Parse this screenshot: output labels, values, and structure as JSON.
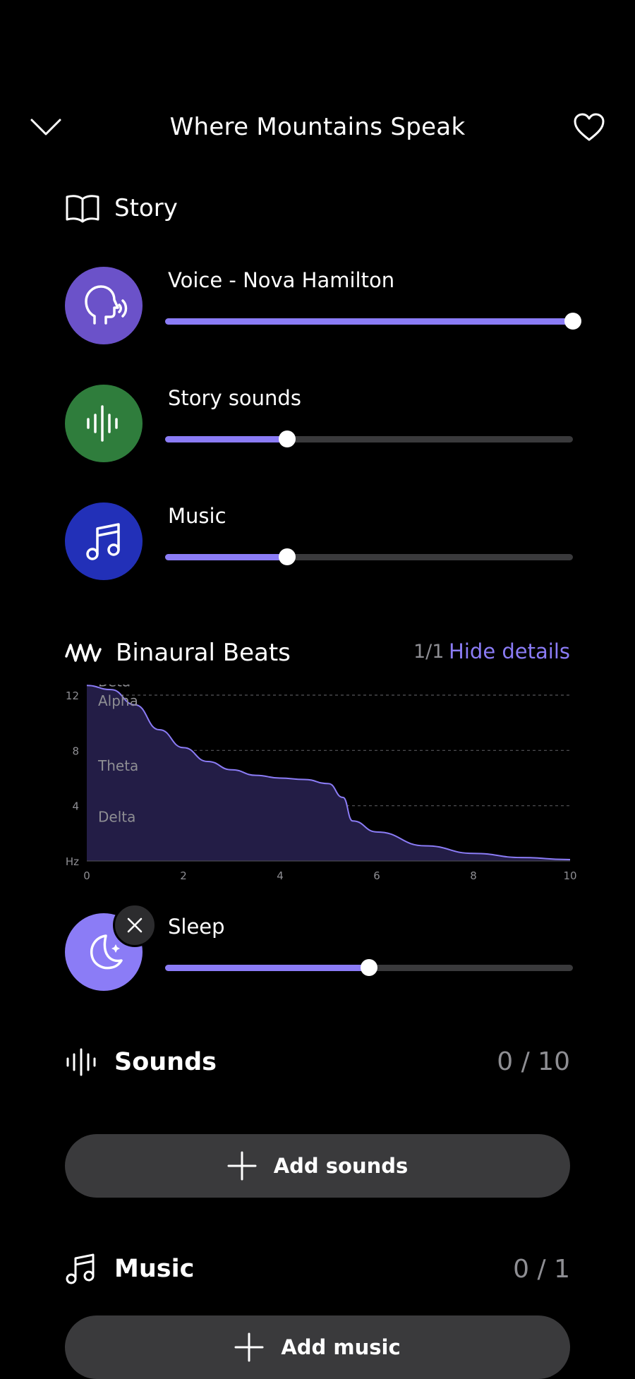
{
  "header": {
    "title": "Where Mountains Speak"
  },
  "story": {
    "label": "Story",
    "rows": [
      {
        "label": "Voice - Nova Hamilton",
        "level": 1.0,
        "color": "#6b52c9"
      },
      {
        "label": "Story sounds",
        "level": 0.3,
        "color": "#2f7d3c"
      },
      {
        "label": "Music",
        "level": 0.3,
        "color": "#2230b8"
      }
    ]
  },
  "binaural": {
    "label": "Binaural Beats",
    "count": "1/1",
    "toggle_label": "Hide details",
    "accent": "#8b7cf6"
  },
  "chart_data": {
    "type": "area",
    "x": [
      0,
      0.5,
      1,
      1.5,
      2,
      2.5,
      3,
      3.5,
      4,
      4.5,
      5,
      5.3,
      5.5,
      6,
      7,
      8,
      9,
      10
    ],
    "y": [
      12.7,
      12.4,
      11.3,
      9.5,
      8.2,
      7.2,
      6.6,
      6.2,
      6.0,
      5.9,
      5.6,
      4.6,
      2.9,
      2.1,
      1.1,
      0.55,
      0.25,
      0.1
    ],
    "xlim": [
      0,
      10
    ],
    "ylim": [
      0,
      13
    ],
    "x_ticks": [
      "0",
      "2",
      "4",
      "6",
      "8",
      "10"
    ],
    "y_ticks": [
      "12",
      "8",
      "4",
      "Hz"
    ],
    "bands": [
      "Beta",
      "Alpha",
      "Theta",
      "Delta"
    ],
    "line_color": "#8b7cf6",
    "fill_color": "#231d46"
  },
  "sleep": {
    "label": "Sleep",
    "level": 0.5,
    "color": "#8b7cf6"
  },
  "sounds": {
    "label": "Sounds",
    "count": "0 / 10",
    "add_label": "Add sounds"
  },
  "music": {
    "label": "Music",
    "count": "0 / 1",
    "add_label": "Add music"
  }
}
